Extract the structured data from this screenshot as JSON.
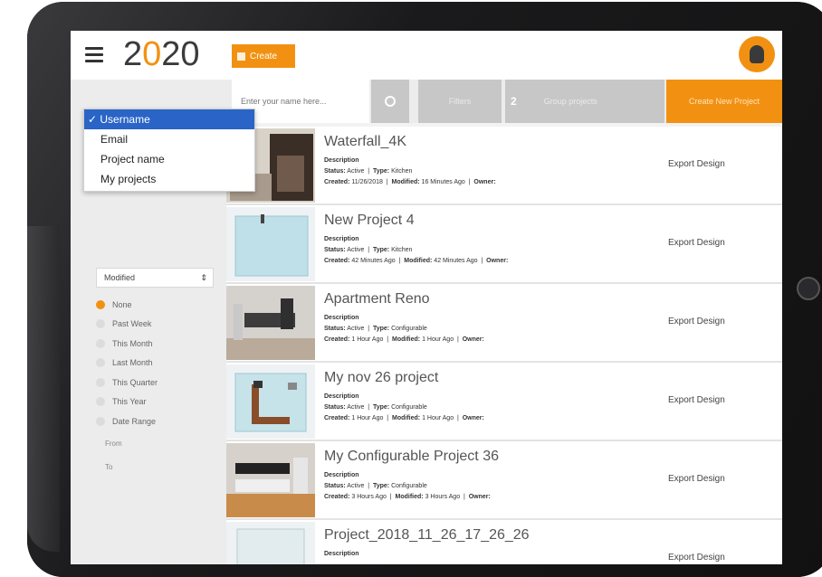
{
  "header": {
    "logo_prefix": "2",
    "logo_zero": "0",
    "logo_suffix": "20",
    "create_label": "Create"
  },
  "toolbar": {
    "search_placeholder": "Enter your name here...",
    "filter_label": "Filters",
    "group_number": "2",
    "group_label": "Group projects",
    "new_label": "Create New Project"
  },
  "search_dropdown": {
    "selected": "Username",
    "items": [
      "Username",
      "Email",
      "Project name",
      "My projects"
    ]
  },
  "sidebar": {
    "sort_value": "Modified",
    "date_filters": [
      "None",
      "Past Week",
      "This Month",
      "Last Month",
      "This Quarter",
      "This Year",
      "Date Range"
    ],
    "selected_filter": "None",
    "from_label": "From",
    "to_label": "To"
  },
  "projects": [
    {
      "name": "Waterfall_4K",
      "desc_label": "Description",
      "status": "Active",
      "type": "Kitchen",
      "created": "11/26/2018",
      "modified": "16 Minutes Ago",
      "export": "Export Design"
    },
    {
      "name": "New Project 4",
      "desc_label": "Description",
      "status": "Active",
      "type": "Kitchen",
      "created": "42 Minutes Ago",
      "modified": "42 Minutes Ago",
      "export": "Export Design"
    },
    {
      "name": "Apartment Reno",
      "desc_label": "Description",
      "status": "Active",
      "type": "Configurable",
      "created": "1 Hour Ago",
      "modified": "1 Hour Ago",
      "export": "Export Design"
    },
    {
      "name": "My nov 26 project",
      "desc_label": "Description",
      "status": "Active",
      "type": "Configurable",
      "created": "1 Hour Ago",
      "modified": "1 Hour Ago",
      "export": "Export Design"
    },
    {
      "name": "My Configurable Project 36",
      "desc_label": "Description",
      "status": "Active",
      "type": "Configurable",
      "created": "3 Hours Ago",
      "modified": "3 Hours Ago",
      "export": "Export Design"
    },
    {
      "name": "Project_2018_11_26_17_26_26",
      "desc_label": "Description",
      "status": "",
      "type": "",
      "created": "",
      "modified": "",
      "export": "Export Design"
    }
  ],
  "labels": {
    "status": "Status:",
    "type": "Type:",
    "created": "Created:",
    "modified": "Modified:",
    "owner": "Owner:"
  },
  "colors": {
    "accent": "#f29111",
    "selected": "#2a64c6"
  }
}
